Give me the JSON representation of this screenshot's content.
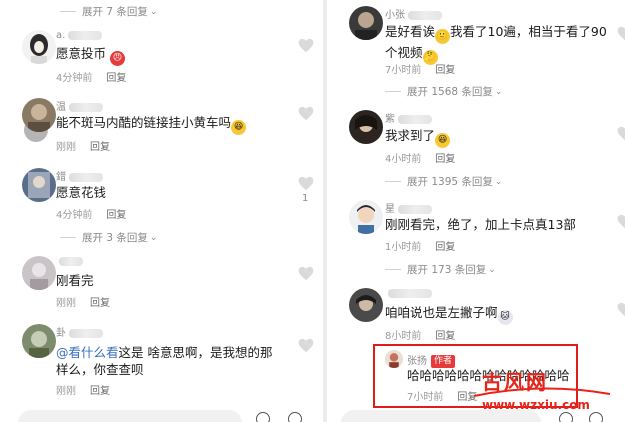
{
  "colors": {
    "accent": "#e01c1c",
    "mention": "#3a6fbf",
    "author_badge": "#e73b3b",
    "watermark": "#e8231a"
  },
  "left": {
    "top_expand": "展开 7 条回复",
    "comments": [
      {
        "username": "a.",
        "text": "愿意投币",
        "emoji": "angry-emoji",
        "time": "4分钟前",
        "reply": "回复"
      },
      {
        "username": "温",
        "text": "能不斑马内酷的链接挂小黄车吗",
        "emoji": "grin-emoji",
        "time": "刚刚",
        "reply": "回复"
      },
      {
        "username": "錯",
        "text": "愿意花钱",
        "time": "4分钟前",
        "reply": "回复",
        "likes": "1"
      },
      {
        "username": "",
        "text": "刚看完",
        "time": "刚刚",
        "reply": "回复"
      },
      {
        "username": "卦",
        "mention": "@看什么看",
        "text": "这是 啥意思啊，是我想的那样么，你查查呗",
        "time": "刚刚",
        "reply": "回复"
      }
    ],
    "mid_expand": "展开 3 条回复"
  },
  "right": {
    "comments": [
      {
        "username": "小张",
        "text": "是好看诶",
        "text2": "我看了10遍，相当于看了90个视频",
        "time": "7小时前",
        "reply": "回复"
      },
      {
        "username": "紫",
        "text": "我求到了",
        "emoji": "grin-emoji",
        "time": "4小时前",
        "reply": "回复"
      },
      {
        "username": "星",
        "text": "刚刚看完，绝了，加上卡点真13部",
        "time": "1小时前",
        "reply": "回复"
      },
      {
        "username": "",
        "text": "咱咱说也是左撇子啊",
        "emoji": "cat-emoji",
        "time": "8小时前",
        "reply": "回复"
      }
    ],
    "expands": [
      "展开 1568 条回复",
      "展开 1395 条回复",
      "展开 173 条回复"
    ],
    "author_reply": {
      "username": "张扬",
      "badge": "作者",
      "text": "哈哈哈哈哈哈哈哈哈哈哈哈哈",
      "time": "7小时前",
      "reply": "回复"
    }
  },
  "watermark": {
    "name": "古风网",
    "url": "www.wzxiu.com"
  }
}
